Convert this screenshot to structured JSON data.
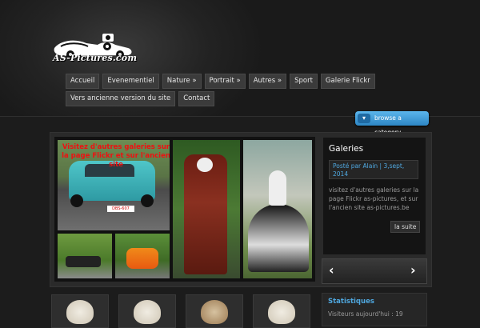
{
  "logo": {
    "text": "AS-Pictures.com"
  },
  "nav": {
    "row1": [
      "Accueil",
      "Evenementiel",
      "Nature »",
      "Portrait »",
      "Autres »",
      "Sport",
      "Galerie Flickr"
    ],
    "row2": [
      "Vers ancienne version du site",
      "Contact"
    ]
  },
  "browse": {
    "label": "browse a category"
  },
  "slider": {
    "overlay_text": "Visitez d'autres galeries sur la page Flickr et sur l'ancien site",
    "plate": "DBS-607"
  },
  "info": {
    "title": "Galeries",
    "meta": "Posté par Alain | 3,sept, 2014",
    "body": "visitez d'autres galeries sur la page Flickr as-pictures, et sur l'ancien site as-pictures.be",
    "more": "la suite"
  },
  "stats": {
    "title": "Statistiques",
    "line": "Visiteurs aujourd'hui : 19"
  },
  "colors": {
    "accent": "#4fa8e0",
    "button": "#3b3b3b",
    "background": "#1c1c1c"
  }
}
